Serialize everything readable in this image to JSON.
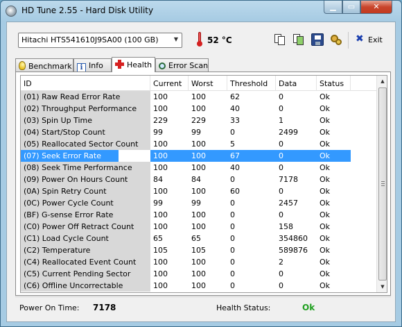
{
  "window": {
    "title": "HD Tune 2.55 - Hard Disk Utility",
    "min_glyph": "▁",
    "max_glyph": "▭",
    "close_glyph": "✕"
  },
  "toolbar": {
    "drive": "Hitachi HTS541610J9SA00 (100 GB)",
    "drive_arrow": "▼",
    "temperature": "52 °C",
    "exit_label": "Exit",
    "exit_glyph": "✖"
  },
  "tabs": [
    {
      "label": "Benchmark",
      "icon": "lightbulb-icon"
    },
    {
      "label": "Info",
      "icon": "info-icon"
    },
    {
      "label": "Health",
      "icon": "red-cross-icon",
      "active": true
    },
    {
      "label": "Error Scan",
      "icon": "magnifier-icon"
    }
  ],
  "table": {
    "columns": [
      "ID",
      "Current",
      "Worst",
      "Threshold",
      "Data",
      "Status"
    ],
    "selected_row": 6,
    "rows": [
      [
        "(01) Raw Read Error Rate",
        "100",
        "100",
        "62",
        "0",
        "Ok"
      ],
      [
        "(02) Throughput Performance",
        "100",
        "100",
        "40",
        "0",
        "Ok"
      ],
      [
        "(03) Spin Up Time",
        "229",
        "229",
        "33",
        "1",
        "Ok"
      ],
      [
        "(04) Start/Stop Count",
        "99",
        "99",
        "0",
        "2499",
        "Ok"
      ],
      [
        "(05) Reallocated Sector Count",
        "100",
        "100",
        "5",
        "0",
        "Ok"
      ],
      [
        "(07) Seek Error Rate",
        "100",
        "100",
        "67",
        "0",
        "Ok"
      ],
      [
        "(08) Seek Time Performance",
        "100",
        "100",
        "40",
        "0",
        "Ok"
      ],
      [
        "(09) Power On Hours Count",
        "84",
        "84",
        "0",
        "7178",
        "Ok"
      ],
      [
        "(0A) Spin Retry Count",
        "100",
        "100",
        "60",
        "0",
        "Ok"
      ],
      [
        "(0C) Power Cycle Count",
        "99",
        "99",
        "0",
        "2457",
        "Ok"
      ],
      [
        "(BF) G-sense Error Rate",
        "100",
        "100",
        "0",
        "0",
        "Ok"
      ],
      [
        "(C0) Power Off Retract Count",
        "100",
        "100",
        "0",
        "158",
        "Ok"
      ],
      [
        "(C1) Load Cycle Count",
        "65",
        "65",
        "0",
        "354860",
        "Ok"
      ],
      [
        "(C2) Temperature",
        "105",
        "105",
        "0",
        "589876",
        "Ok"
      ],
      [
        "(C4) Reallocated Event Count",
        "100",
        "100",
        "0",
        "2",
        "Ok"
      ],
      [
        "(C5) Current Pending Sector",
        "100",
        "100",
        "0",
        "0",
        "Ok"
      ],
      [
        "(C6) Offline Uncorrectable",
        "100",
        "100",
        "0",
        "0",
        "Ok"
      ]
    ]
  },
  "scrollbar": {
    "up_glyph": "▲",
    "down_glyph": "▼"
  },
  "status": {
    "power_on_label": "Power On Time:",
    "power_on_value": "7178",
    "health_label": "Health Status:",
    "health_value": "Ok"
  },
  "colors": {
    "selection": "#3399ff",
    "ok": "#20a020",
    "id_column_bg": "#d8d8d8"
  }
}
